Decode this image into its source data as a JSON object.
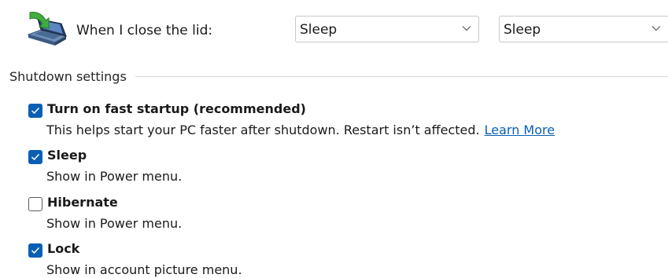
{
  "lid_setting": {
    "label": "When I close the lid:",
    "on_battery_value": "Sleep",
    "plugged_in_value": "Sleep",
    "icon": "laptop-lid-icon"
  },
  "shutdown_settings": {
    "title": "Shutdown settings",
    "options": [
      {
        "label": "Turn on fast startup (recommended)",
        "description": "This helps start your PC faster after shutdown. Restart isn’t affected.",
        "link": "Learn More",
        "checked": true
      },
      {
        "label": "Sleep",
        "description": "Show in Power menu.",
        "checked": true
      },
      {
        "label": "Hibernate",
        "description": "Show in Power menu.",
        "checked": false
      },
      {
        "label": "Lock",
        "description": "Show in account picture menu.",
        "checked": true
      }
    ]
  },
  "colors": {
    "accent": "#0a5fb4",
    "text": "#1a1a1a",
    "divider": "#d6d6d6",
    "unchecked_border": "#5c5c5c"
  }
}
